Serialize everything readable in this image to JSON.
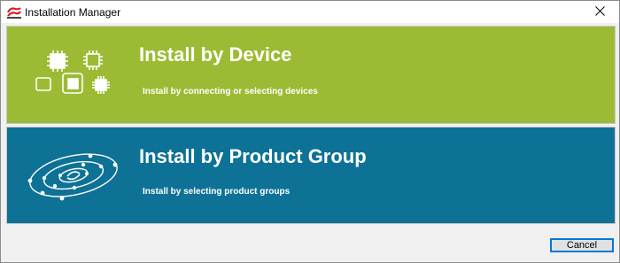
{
  "window": {
    "title": "Installation Manager",
    "app_icon": "silicon-labs-logo-icon",
    "close_icon": "close-icon"
  },
  "options": [
    {
      "heading": "Install by Device",
      "description": "Install by connecting or selecting devices",
      "icon": "chips-icon",
      "color": "#9cbb34"
    },
    {
      "heading": "Install by Product Group",
      "description": "Install by selecting product groups",
      "icon": "orbit-icon",
      "color": "#0e7297"
    }
  ],
  "footer": {
    "cancel_label": "Cancel"
  }
}
